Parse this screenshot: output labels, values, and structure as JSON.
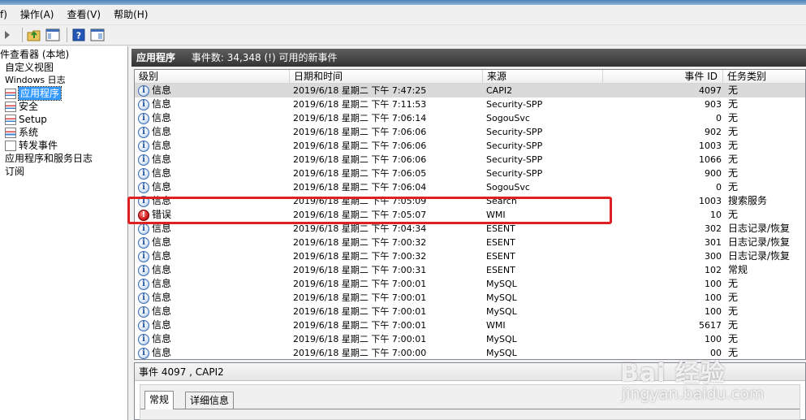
{
  "menu": [
    "f)",
    "操作(A)",
    "查看(V)",
    "帮助(H)"
  ],
  "toolbar": {
    "icons": [
      "back-arrow-icon",
      "up-folder-icon",
      "show-hide-tree-icon",
      "help-icon",
      "properties-icon"
    ]
  },
  "tree": [
    {
      "label": "件查看器 (本地)",
      "indent": 0,
      "icon": ""
    },
    {
      "label": "自定义视图",
      "indent": 1,
      "icon": ""
    },
    {
      "label": "Windows 日志",
      "indent": 1,
      "icon": ""
    },
    {
      "label": "应用程序",
      "indent": 2,
      "icon": "log",
      "selected": true
    },
    {
      "label": "安全",
      "indent": 2,
      "icon": "log"
    },
    {
      "label": "Setup",
      "indent": 2,
      "icon": "log"
    },
    {
      "label": "系统",
      "indent": 2,
      "icon": "log"
    },
    {
      "label": "转发事件",
      "indent": 2,
      "icon": "fwd"
    },
    {
      "label": "应用程序和服务日志",
      "indent": 1,
      "icon": ""
    },
    {
      "label": "订阅",
      "indent": 1,
      "icon": ""
    }
  ],
  "header": {
    "title": "应用程序",
    "event_count": "事件数: 34,348 (!) 可用的新事件"
  },
  "columns": {
    "level": "级别",
    "datetime": "日期和时间",
    "source": "来源",
    "event_id": "事件 ID",
    "category": "任务类别"
  },
  "rows": [
    {
      "level": "信息",
      "type": "info",
      "datetime": "2019/6/18 星期二 下午 7:47:25",
      "source": "CAPI2",
      "id": "4097",
      "category": "无",
      "selected": true
    },
    {
      "level": "信息",
      "type": "info",
      "datetime": "2019/6/18 星期二 下午 7:11:53",
      "source": "Security-SPP",
      "id": "903",
      "category": "无"
    },
    {
      "level": "信息",
      "type": "info",
      "datetime": "2019/6/18 星期二 下午 7:06:14",
      "source": "SogouSvc",
      "id": "0",
      "category": "无"
    },
    {
      "level": "信息",
      "type": "info",
      "datetime": "2019/6/18 星期二 下午 7:06:06",
      "source": "Security-SPP",
      "id": "902",
      "category": "无"
    },
    {
      "level": "信息",
      "type": "info",
      "datetime": "2019/6/18 星期二 下午 7:06:06",
      "source": "Security-SPP",
      "id": "1003",
      "category": "无"
    },
    {
      "level": "信息",
      "type": "info",
      "datetime": "2019/6/18 星期二 下午 7:06:06",
      "source": "Security-SPP",
      "id": "1066",
      "category": "无"
    },
    {
      "level": "信息",
      "type": "info",
      "datetime": "2019/6/18 星期二 下午 7:06:05",
      "source": "Security-SPP",
      "id": "900",
      "category": "无"
    },
    {
      "level": "信息",
      "type": "info",
      "datetime": "2019/6/18 星期二 下午 7:06:04",
      "source": "SogouSvc",
      "id": "0",
      "category": "无"
    },
    {
      "level": "信息",
      "type": "info",
      "datetime": "2019/6/18 星期二 下午 7:05:09",
      "source": "Search",
      "id": "1003",
      "category": "搜索服务"
    },
    {
      "level": "错误",
      "type": "error",
      "datetime": "2019/6/18 星期二 下午 7:05:07",
      "source": "WMI",
      "id": "10",
      "category": "无"
    },
    {
      "level": "信息",
      "type": "info",
      "datetime": "2019/6/18 星期二 下午 7:04:34",
      "source": "ESENT",
      "id": "302",
      "category": "日志记录/恢复"
    },
    {
      "level": "信息",
      "type": "info",
      "datetime": "2019/6/18 星期二 下午 7:00:32",
      "source": "ESENT",
      "id": "301",
      "category": "日志记录/恢复"
    },
    {
      "level": "信息",
      "type": "info",
      "datetime": "2019/6/18 星期二 下午 7:00:32",
      "source": "ESENT",
      "id": "300",
      "category": "日志记录/恢复"
    },
    {
      "level": "信息",
      "type": "info",
      "datetime": "2019/6/18 星期二 下午 7:00:31",
      "source": "ESENT",
      "id": "102",
      "category": "常规"
    },
    {
      "level": "信息",
      "type": "info",
      "datetime": "2019/6/18 星期二 下午 7:00:01",
      "source": "MySQL",
      "id": "100",
      "category": "无"
    },
    {
      "level": "信息",
      "type": "info",
      "datetime": "2019/6/18 星期二 下午 7:00:01",
      "source": "MySQL",
      "id": "100",
      "category": "无"
    },
    {
      "level": "信息",
      "type": "info",
      "datetime": "2019/6/18 星期二 下午 7:00:01",
      "source": "MySQL",
      "id": "100",
      "category": "无"
    },
    {
      "level": "信息",
      "type": "info",
      "datetime": "2019/6/18 星期二 下午 7:00:01",
      "source": "WMI",
      "id": "5617",
      "category": "无"
    },
    {
      "level": "信息",
      "type": "info",
      "datetime": "2019/6/18 星期二 下午 7:00:01",
      "source": "MySQL",
      "id": "100",
      "category": "无"
    },
    {
      "level": "信息",
      "type": "info",
      "datetime": "2019/6/18 星期二 下午 7:00:00",
      "source": "MySQL",
      "id": "00",
      "category": "无"
    }
  ],
  "detail": {
    "title": "事件 4097 , CAPI2",
    "tabs": [
      "常规",
      "详细信息"
    ]
  },
  "watermark": {
    "main": "Bai 经验",
    "sub": "jingyan.baidu.com"
  },
  "colors": {
    "highlight": "#e02020",
    "selection": "#3399ff"
  }
}
